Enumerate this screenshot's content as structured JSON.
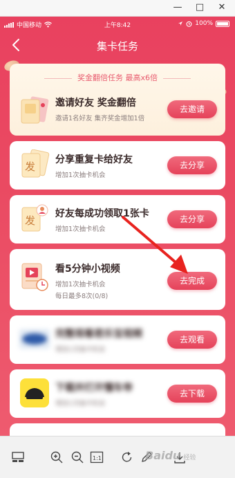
{
  "window": {
    "minimize": "—",
    "maximize": "□",
    "close": "✕"
  },
  "status": {
    "carrier": "中国移动",
    "time": "上午8:42",
    "battery": "100%"
  },
  "nav": {
    "title": "集卡任务"
  },
  "bonus": {
    "header": "奖金翻倍任务  最高x6倍",
    "title": "邀请好友 奖金翻倍",
    "subtitle": "邀请1名好友 集齐奖金增加1倍",
    "button": "去邀请"
  },
  "tasks": [
    {
      "title": "分享重复卡给好友",
      "subtitle": "增加1次抽卡机会",
      "button": "去分享",
      "icon": "fa-card-icon"
    },
    {
      "title": "好友每成功领取1张卡",
      "subtitle": "增加1次抽卡机会",
      "button": "去分享",
      "icon": "fa-card-user-icon"
    },
    {
      "title": "看5分钟小视频",
      "subtitle": "增加1次抽卡机会",
      "subtitle2": "每日最多8次(0/8)",
      "button": "去完成",
      "icon": "video-icon"
    },
    {
      "title": "完整观看君乐宝视频",
      "subtitle": "增加1次抽卡机会",
      "button": "去观看",
      "icon": "brand-logo-icon"
    },
    {
      "title": "下载并打开懂车帝",
      "subtitle": "增加1次抽卡机会",
      "button": "去下载",
      "icon": "car-app-icon"
    }
  ],
  "watermark": {
    "brand": "Baidu",
    "sub": "经验"
  },
  "colors": {
    "primary": "#e9415f",
    "button": "#e5425a",
    "bonus_bg": "#fdf0dd",
    "arrow": "#e8231f"
  }
}
